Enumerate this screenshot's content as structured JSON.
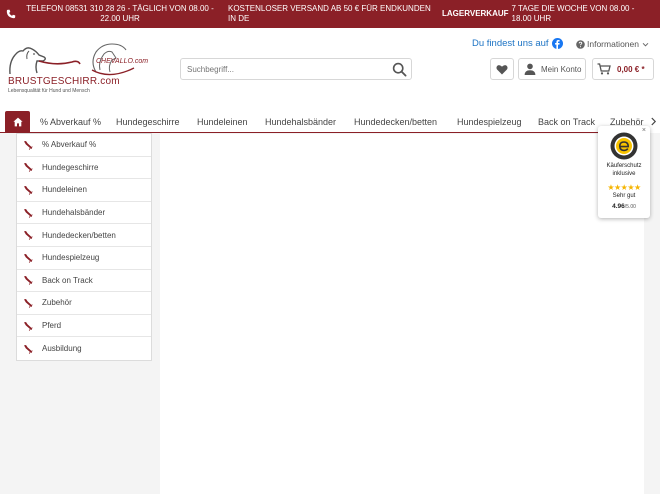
{
  "topbar": {
    "phone_text": "TELEFON 08531 310 28 26 - TÄGLICH VON 08.00 - 22.00 UHR",
    "shipping_text": "KOSTENLOSER VERSAND AB 50 € FÜR ENDKUNDEN IN DE",
    "store_bold": "LAGERVERKAUF",
    "store_text": "7 TAGE DIE WOCHE VON 08.00 - 18.00 UHR"
  },
  "header": {
    "logo_brand": "BRUSTGESCHIRR.com",
    "logo_tagline": "Lebensqualität für Hund und Mensch",
    "logo2_brand": "CHEVALLO.com",
    "search_placeholder": "Suchbegriff...",
    "find_us": "Du findest uns auf",
    "info_label": "Informationen",
    "account_label": "Mein Konto",
    "cart_total": "0,00 € *"
  },
  "nav": {
    "items": [
      "% Abverkauf %",
      "Hundegeschirre",
      "Hundeleinen",
      "Hundehalsbänder",
      "Hundedecken/betten",
      "Hundespielzeug",
      "Back on Track",
      "Zubehör"
    ]
  },
  "menu": {
    "items": [
      "% Abverkauf %",
      "Hundegeschirre",
      "Hundeleinen",
      "Hundehalsbänder",
      "Hundedecken/betten",
      "Hundespielzeug",
      "Back on Track",
      "Zubehör",
      "Pferd",
      "Ausbildung"
    ]
  },
  "trust": {
    "line1": "Käuferschutz",
    "line2": "inklusive",
    "stars": "★★★★★",
    "rating_text": "Sehr gut",
    "score": "4.96",
    "score_max": "/5.00"
  },
  "colors": {
    "brand": "#8b2027",
    "link": "#1c73c4",
    "stars": "#f5b400"
  }
}
